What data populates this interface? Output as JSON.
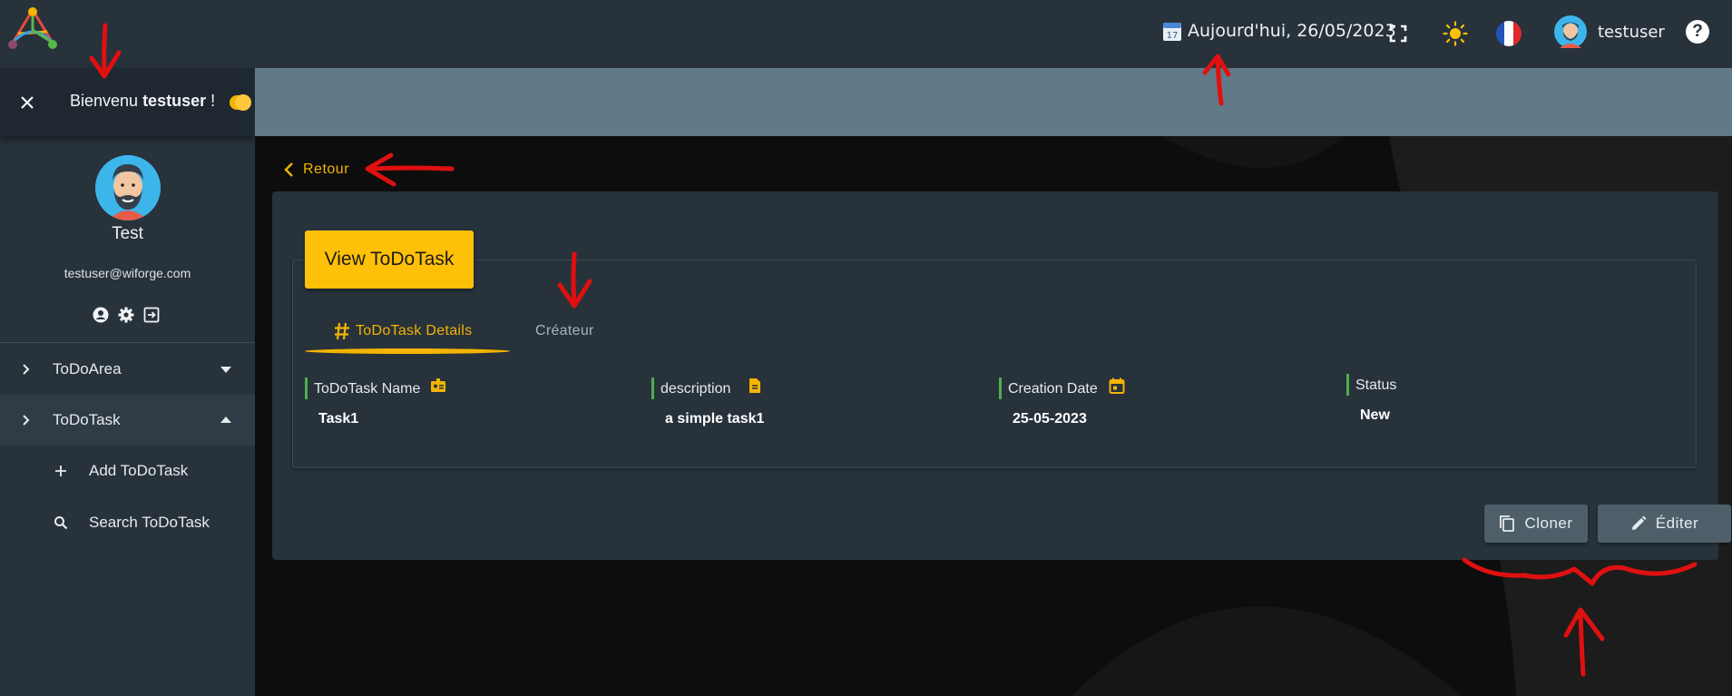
{
  "header": {
    "date_label": "Aujourd'hui, 26/05/2023",
    "username": "testuser",
    "calendar_day": "17",
    "help_label": "?"
  },
  "sidebar": {
    "welcome_prefix": "Bienvenu ",
    "welcome_user": "testuser",
    "welcome_suffix": " !",
    "profile_name": "Test",
    "profile_email": "testuser@wiforge.com",
    "nav": [
      {
        "label": "ToDoArea",
        "expanded": false
      },
      {
        "label": "ToDoTask",
        "expanded": true
      }
    ],
    "subitems": [
      {
        "label": "Add ToDoTask",
        "icon": "plus-icon"
      },
      {
        "label": "Search ToDoTask",
        "icon": "search-icon"
      }
    ]
  },
  "main": {
    "back_label": "Retour",
    "view_title": "View ToDoTask",
    "tabs": [
      {
        "label": "ToDoTask Details",
        "active": true
      },
      {
        "label": "Créateur",
        "active": false
      }
    ],
    "fields": [
      {
        "label": "ToDoTask Name",
        "value": "Task1",
        "icon": "id-badge-icon"
      },
      {
        "label": "description",
        "value": "a simple task1",
        "icon": "document-icon"
      },
      {
        "label": "Creation Date",
        "value": "25-05-2023",
        "icon": "calendar-icon"
      },
      {
        "label": "Status",
        "value": "New",
        "icon": ""
      }
    ],
    "buttons": {
      "clone_label": "Cloner",
      "edit_label": "Éditer"
    }
  },
  "colors": {
    "accent": "#f4b400",
    "panel": "#27323b",
    "banner": "#607a89",
    "field_marker": "#4caf50",
    "annotation": "#e01010"
  }
}
